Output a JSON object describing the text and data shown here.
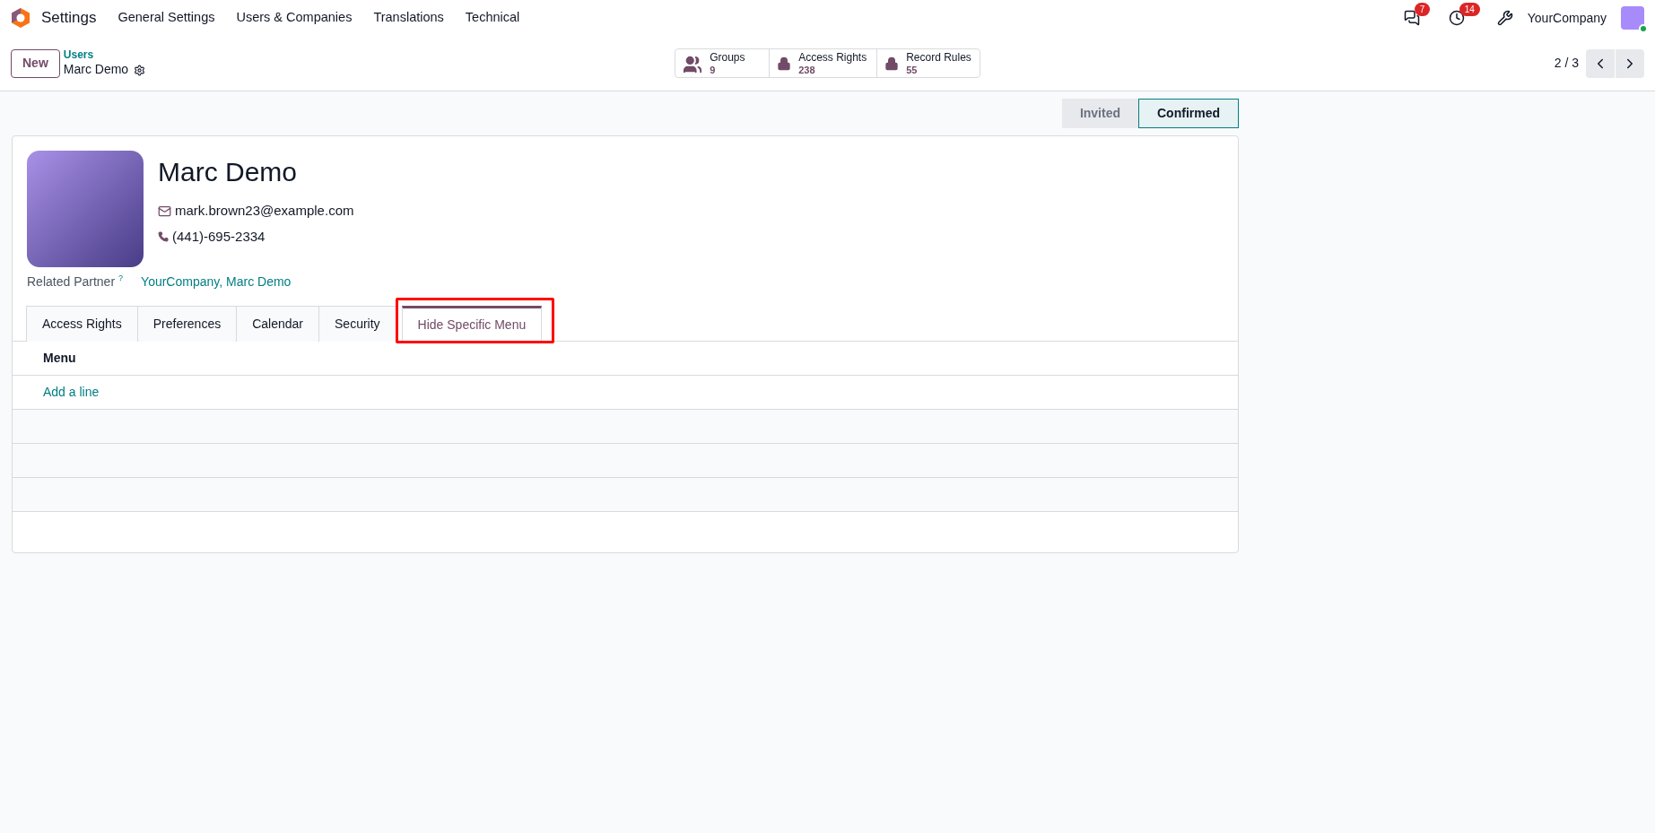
{
  "app": {
    "name": "Settings"
  },
  "menu": [
    "General Settings",
    "Users & Companies",
    "Translations",
    "Technical"
  ],
  "systray": {
    "messages_badge": "7",
    "activities_badge": "14",
    "company": "YourCompany",
    "online": true
  },
  "control_panel": {
    "new_button": "New",
    "breadcrumb": "Users",
    "record": "Marc Demo",
    "pager": "2 / 3"
  },
  "smart_buttons": [
    {
      "kind": "groups",
      "label": "Groups",
      "value": "9"
    },
    {
      "kind": "lock",
      "label": "Access Rights",
      "value": "238"
    },
    {
      "kind": "lock",
      "label": "Record Rules",
      "value": "55"
    }
  ],
  "stages": [
    {
      "label": "Invited",
      "selected": false
    },
    {
      "label": "Confirmed",
      "selected": true
    }
  ],
  "user": {
    "name": "Marc Demo",
    "email": "mark.brown23@example.com",
    "phone": "(441)-695-2334",
    "related_partner_label": "Related Partner",
    "related_partner_help": "?",
    "related_partner": "YourCompany, Marc Demo"
  },
  "tabs": [
    {
      "label": "Access Rights",
      "selected": false,
      "highlighted": false
    },
    {
      "label": "Preferences",
      "selected": false,
      "highlighted": false
    },
    {
      "label": "Calendar",
      "selected": false,
      "highlighted": false
    },
    {
      "label": "Security",
      "selected": false,
      "highlighted": false
    },
    {
      "label": "Hide Specific Menu",
      "selected": true,
      "highlighted": true
    }
  ],
  "table": {
    "columns": [
      "Menu"
    ],
    "add_line": "Add a line"
  }
}
